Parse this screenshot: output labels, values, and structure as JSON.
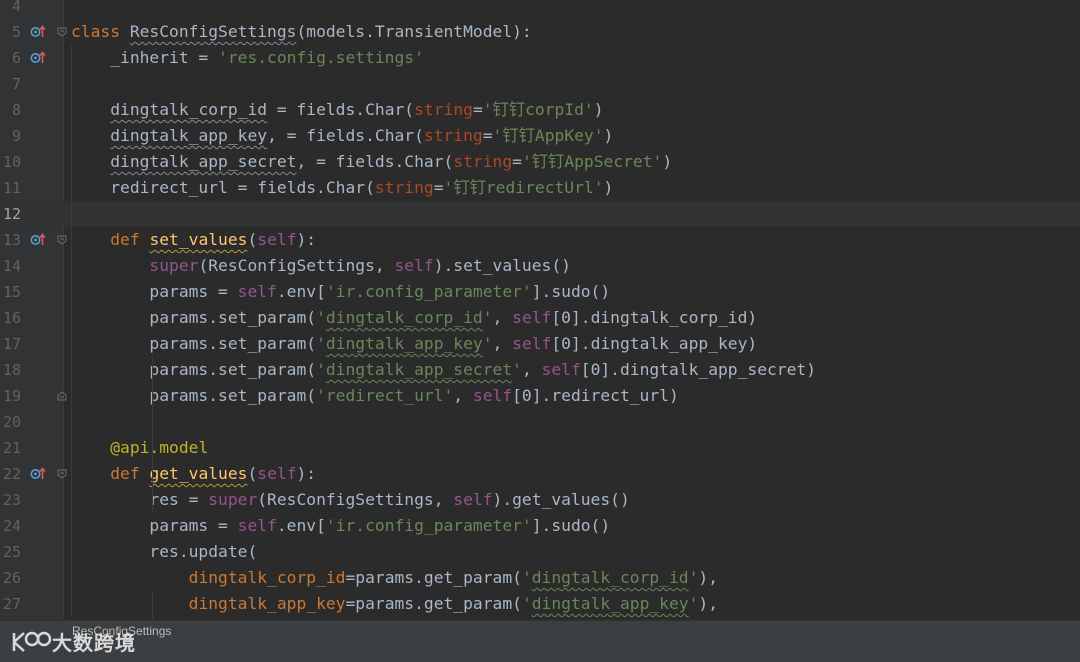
{
  "editor": {
    "lines": [
      {
        "n": "4"
      },
      {
        "n": "5",
        "marker": "override",
        "fold": "open",
        "code": [
          [
            "t-kw",
            "class "
          ],
          [
            "sq-g",
            "ResConfigSettings"
          ],
          [
            "",
            "(models.TransientModel):"
          ]
        ]
      },
      {
        "n": "6",
        "marker": "override",
        "code": [
          [
            "",
            "    _inherit = "
          ],
          [
            "t-str",
            "'res.config.settings'"
          ]
        ]
      },
      {
        "n": "7"
      },
      {
        "n": "8",
        "code": [
          [
            "",
            "    "
          ],
          [
            "sq-g",
            "dingtalk_corp_id"
          ],
          [
            "",
            " = fields.Char("
          ],
          [
            "t-param",
            "string"
          ],
          [
            "",
            "="
          ],
          [
            "t-str",
            "'钉钉corpId'"
          ],
          [
            "",
            ")"
          ]
        ]
      },
      {
        "n": "9",
        "code": [
          [
            "",
            "    "
          ],
          [
            "sq-g",
            "dingtalk_app_key"
          ],
          [
            "",
            ", = fields.Char("
          ],
          [
            "t-param",
            "string"
          ],
          [
            "",
            "="
          ],
          [
            "t-str",
            "'钉钉AppKey'"
          ],
          [
            "",
            ")"
          ]
        ]
      },
      {
        "n": "10",
        "code": [
          [
            "",
            "    "
          ],
          [
            "sq-g",
            "dingtalk_app_secret"
          ],
          [
            "",
            ", = fields.Char("
          ],
          [
            "t-param",
            "string"
          ],
          [
            "",
            "="
          ],
          [
            "t-str",
            "'钉钉AppSecret'"
          ],
          [
            "",
            ")"
          ]
        ]
      },
      {
        "n": "11",
        "code": [
          [
            "",
            "    redirect_url = fields.Char("
          ],
          [
            "t-param",
            "string"
          ],
          [
            "",
            "="
          ],
          [
            "t-str",
            "'钉钉redirectUrl'"
          ],
          [
            "",
            ")"
          ]
        ]
      },
      {
        "n": "12",
        "current": true
      },
      {
        "n": "13",
        "marker": "override",
        "fold": "open",
        "code": [
          [
            "",
            "    "
          ],
          [
            "t-kw",
            "def "
          ],
          [
            "sq-y t-def",
            "set_values"
          ],
          [
            "",
            "("
          ],
          [
            "t-self",
            "self"
          ],
          [
            "",
            "):"
          ]
        ]
      },
      {
        "n": "14",
        "code": [
          [
            "",
            "        "
          ],
          [
            "t-self",
            "super"
          ],
          [
            "",
            "(ResConfigSettings, "
          ],
          [
            "t-self",
            "self"
          ],
          [
            "",
            ").set_values()"
          ]
        ]
      },
      {
        "n": "15",
        "code": [
          [
            "",
            "        params = "
          ],
          [
            "t-self",
            "self"
          ],
          [
            "",
            ".env["
          ],
          [
            "t-str",
            "'ir.config_parameter'"
          ],
          [
            "",
            "].sudo()"
          ]
        ]
      },
      {
        "n": "16",
        "code": [
          [
            "",
            "        params.set_param("
          ],
          [
            "t-str",
            "'"
          ],
          [
            "t-str sq-w",
            "dingtalk_corp_id"
          ],
          [
            "t-str",
            "'"
          ],
          [
            "",
            ", "
          ],
          [
            "t-self",
            "self"
          ],
          [
            "",
            "[0].dingtalk_corp_id)"
          ]
        ]
      },
      {
        "n": "17",
        "code": [
          [
            "",
            "        params.set_param("
          ],
          [
            "t-str",
            "'"
          ],
          [
            "t-str sq-w",
            "dingtalk_app_key"
          ],
          [
            "t-str",
            "'"
          ],
          [
            "",
            ", "
          ],
          [
            "t-self",
            "self"
          ],
          [
            "",
            "[0].dingtalk_app_key)"
          ]
        ]
      },
      {
        "n": "18",
        "code": [
          [
            "",
            "        params.set_param("
          ],
          [
            "t-str",
            "'"
          ],
          [
            "t-str sq-w",
            "dingtalk_app_secret"
          ],
          [
            "t-str",
            "'"
          ],
          [
            "",
            ", "
          ],
          [
            "t-self",
            "self"
          ],
          [
            "",
            "[0].dingtalk_app_secret)"
          ]
        ]
      },
      {
        "n": "19",
        "fold": "close",
        "code": [
          [
            "",
            "        params.set_param("
          ],
          [
            "t-str",
            "'redirect_url'"
          ],
          [
            "",
            ", "
          ],
          [
            "t-self",
            "self"
          ],
          [
            "",
            "[0].redirect_url)"
          ]
        ]
      },
      {
        "n": "20"
      },
      {
        "n": "21",
        "code": [
          [
            "",
            "    "
          ],
          [
            "t-dec",
            "@api.model"
          ]
        ]
      },
      {
        "n": "22",
        "marker": "override",
        "fold": "open",
        "code": [
          [
            "",
            "    "
          ],
          [
            "t-kw",
            "def "
          ],
          [
            "sq-y t-def",
            "get_values"
          ],
          [
            "",
            "("
          ],
          [
            "t-self",
            "self"
          ],
          [
            "",
            "):"
          ]
        ]
      },
      {
        "n": "23",
        "code": [
          [
            "",
            "        res = "
          ],
          [
            "t-self",
            "super"
          ],
          [
            "",
            "(ResConfigSettings, "
          ],
          [
            "t-self",
            "self"
          ],
          [
            "",
            ").get_values()"
          ]
        ]
      },
      {
        "n": "24",
        "code": [
          [
            "",
            "        params = "
          ],
          [
            "t-self",
            "self"
          ],
          [
            "",
            ".env["
          ],
          [
            "t-str",
            "'ir.config_parameter'"
          ],
          [
            "",
            "].sudo()"
          ]
        ]
      },
      {
        "n": "25",
        "code": [
          [
            "",
            "        res.update("
          ]
        ]
      },
      {
        "n": "26",
        "code": [
          [
            "",
            "            "
          ],
          [
            "t-orange",
            "dingtalk_corp_id"
          ],
          [
            "",
            "=params.get_param("
          ],
          [
            "t-str",
            "'"
          ],
          [
            "t-str sq-w",
            "dingtalk_corp_id"
          ],
          [
            "t-str",
            "'"
          ],
          [
            "",
            "),"
          ]
        ]
      },
      {
        "n": "27",
        "code": [
          [
            "",
            "            "
          ],
          [
            "t-orange",
            "dingtalk_app_key"
          ],
          [
            "",
            "=params.get_param("
          ],
          [
            "t-str",
            "'"
          ],
          [
            "t-str sq-w",
            "dingtalk_app_key"
          ],
          [
            "t-str",
            "'"
          ],
          [
            "",
            "),"
          ]
        ]
      }
    ]
  },
  "status": {
    "breadcrumb": "ResConfigSettings"
  },
  "watermark": {
    "text": "大数跨境"
  },
  "colors": {
    "background": "#2b2b2b",
    "gutter": "#313335",
    "keyword": "#cc7832",
    "string": "#6a8759",
    "self": "#94558d",
    "function": "#ffc66d",
    "decorator": "#bbb529"
  }
}
